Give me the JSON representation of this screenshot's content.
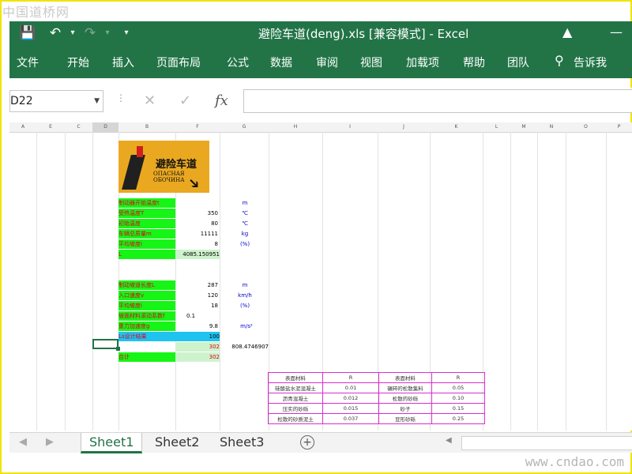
{
  "watermark": {
    "top": "中国道桥网",
    "bottom": "www.cndao.com"
  },
  "titlebar": {
    "title": "避险车道(deng).xls [兼容模式] - Excel"
  },
  "ribbon": {
    "tabs": [
      "文件",
      "开始",
      "插入",
      "页面布局",
      "公式",
      "数据",
      "审阅",
      "视图",
      "加载项",
      "帮助",
      "团队",
      "告诉我"
    ]
  },
  "formula_bar": {
    "name_box": "D22",
    "fx": "fx",
    "formula": ""
  },
  "columns": [
    "A",
    "E",
    "C",
    "D",
    "B",
    "F",
    "G",
    "H",
    "I",
    "J",
    "K",
    "L",
    "M",
    "N",
    "O",
    "P"
  ],
  "sign": {
    "text_cn": "避险车道",
    "text_ru": "ОПАСНАЯ ОБОЧИНА"
  },
  "block1": {
    "labels": [
      "制动器开始温度t",
      "受热温度T",
      "初始温度",
      "车辆总质量m",
      "平均坡度i",
      "L"
    ],
    "values": [
      "",
      "350",
      "80",
      "11111",
      "8",
      "4085.150951"
    ],
    "units": [
      "m",
      "℃",
      "℃",
      "kg",
      "(%)",
      ""
    ]
  },
  "block2": {
    "labels": [
      "制动坡道长度L",
      "入口速度v",
      "平均坡度i",
      "坡面材料滚动系数f",
      "重力加速度g",
      "Ls设计结果",
      "",
      " 合计"
    ],
    "values": [
      "287",
      "120",
      "18",
      "0.1",
      "9.8",
      "100",
      "302",
      "302"
    ],
    "units": [
      "m",
      "km/h",
      "(%)",
      "",
      "m/s²",
      "",
      "808.4746907",
      ""
    ]
  },
  "materials_table": {
    "headers": [
      "表面材料",
      "R",
      "表面材料",
      "R"
    ],
    "rows": [
      [
        "硅酸盐水泥混凝土",
        "0.01",
        "碾碎的松散集料",
        "0.05"
      ],
      [
        "沥青混凝土",
        "0.012",
        "松散的砂砾",
        "0.10"
      ],
      [
        "压实的砂砾",
        "0.015",
        "砂子",
        "0.15"
      ],
      [
        "松散的砂质泥土",
        "0.037",
        "豆形砂砾",
        "0.25"
      ]
    ]
  },
  "sheets": [
    "Sheet1",
    "Sheet2",
    "Sheet3"
  ],
  "active_sheet": "Sheet1",
  "colors": {
    "excel_green": "#227447",
    "cell_green": "#16f516",
    "cell_blue": "#1fc3f0",
    "table_border": "#d82fcf"
  }
}
